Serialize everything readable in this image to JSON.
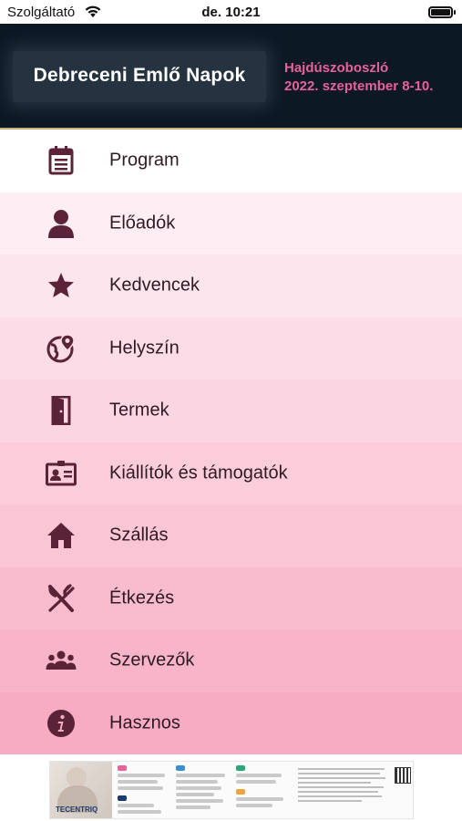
{
  "status_bar": {
    "carrier": "Szolgáltató",
    "time": "de. 10:21"
  },
  "header": {
    "title": "Debreceni Emlő Napok",
    "location": "Hajdúszoboszló",
    "dates": "2022. szeptember 8-10."
  },
  "colors": {
    "header_bg": "#0c1824",
    "accent_pink": "#e8629a",
    "icon_color": "#5a2337",
    "label_color": "#2e1a24"
  },
  "menu": [
    {
      "label": "Program",
      "icon": "calendar-icon",
      "bg": "#ffffff"
    },
    {
      "label": "Előadók",
      "icon": "person-icon",
      "bg": "#feeef3"
    },
    {
      "label": "Kedvencek",
      "icon": "star-icon",
      "bg": "#fde5ed"
    },
    {
      "label": "Helyszín",
      "icon": "globe-location-icon",
      "bg": "#fcdde7"
    },
    {
      "label": "Termek",
      "icon": "door-icon",
      "bg": "#fbd5e1"
    },
    {
      "label": "Kiállítók és támogatók",
      "icon": "id-card-icon",
      "bg": "#fbcddb"
    },
    {
      "label": "Szállás",
      "icon": "home-icon",
      "bg": "#fac5d5"
    },
    {
      "label": "Étkezés",
      "icon": "fork-knife-icon",
      "bg": "#f9bccf"
    },
    {
      "label": "Szervezők",
      "icon": "group-icon",
      "bg": "#f8b4c9"
    },
    {
      "label": "Hasznos",
      "icon": "info-icon",
      "bg": "#f7acc3"
    }
  ],
  "banner": {
    "brand": "TECENTRIQ"
  }
}
